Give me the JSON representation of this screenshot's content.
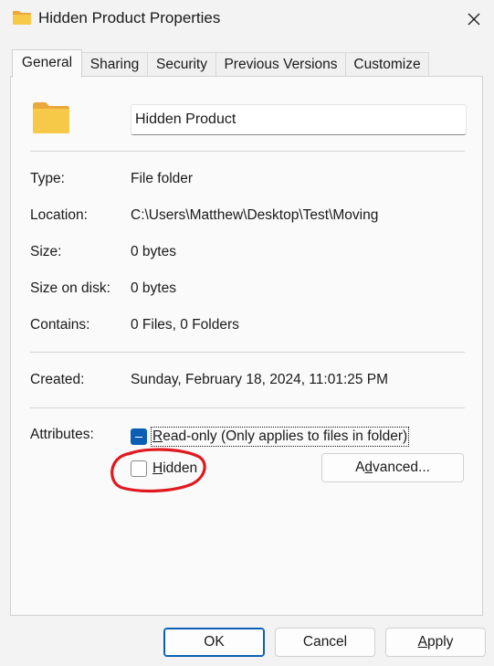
{
  "window": {
    "title": "Hidden Product Properties",
    "close_icon": "close-icon",
    "title_icon": "folder-icon"
  },
  "tabs": [
    {
      "label": "General",
      "active": true
    },
    {
      "label": "Sharing",
      "active": false
    },
    {
      "label": "Security",
      "active": false
    },
    {
      "label": "Previous Versions",
      "active": false
    },
    {
      "label": "Customize",
      "active": false
    }
  ],
  "general": {
    "folder_icon": "folder-icon",
    "name": "Hidden Product",
    "type_label": "Type:",
    "type_value": "File folder",
    "location_label": "Location:",
    "location_value": "C:\\Users\\Matthew\\Desktop\\Test\\Moving",
    "size_label": "Size:",
    "size_value": "0 bytes",
    "size_on_disk_label": "Size on disk:",
    "size_on_disk_value": "0 bytes",
    "contains_label": "Contains:",
    "contains_value": "0 Files, 0 Folders",
    "created_label": "Created:",
    "created_value": "Sunday, February 18, 2024, 11:01:25 PM",
    "attributes_label": "Attributes:",
    "readonly": {
      "label_pre": "",
      "label_u": "R",
      "label_post": "ead-only (Only applies to files in folder)",
      "state": "indeterminate"
    },
    "hidden": {
      "label_pre": "",
      "label_u": "H",
      "label_post": "idden",
      "state": "unchecked"
    },
    "advanced": {
      "label_pre": "A",
      "label_u": "d",
      "label_post": "vanced..."
    }
  },
  "buttons": {
    "ok": "OK",
    "cancel": "Cancel",
    "apply_u": "A",
    "apply_post": "pply"
  },
  "colors": {
    "accent": "#0a5fb4",
    "annotation": "#e0191f",
    "folder": "#f7c948"
  }
}
